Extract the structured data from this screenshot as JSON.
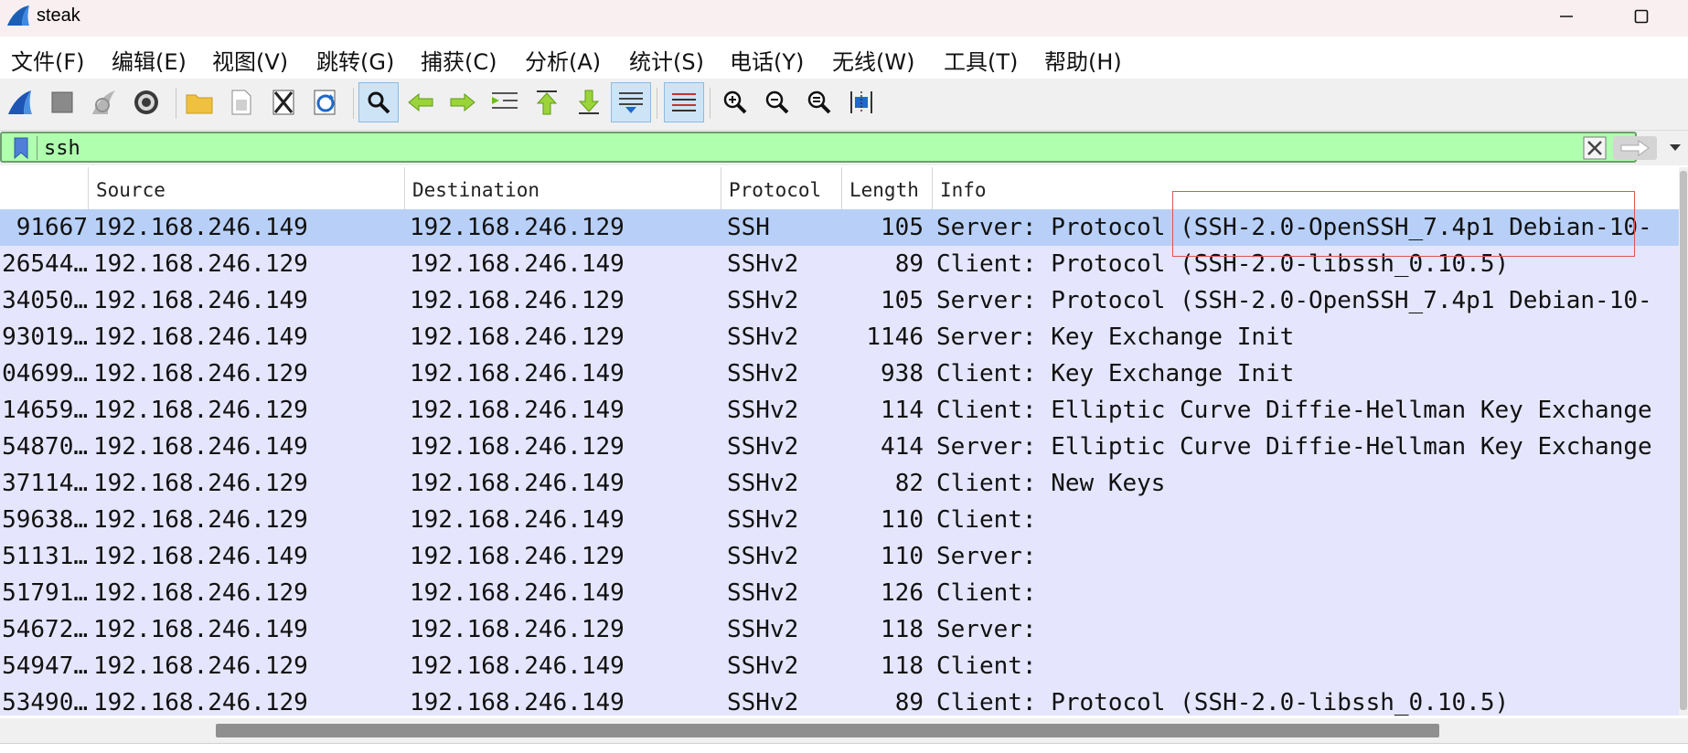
{
  "window": {
    "title": "steak",
    "minimize_label": "—",
    "maximize_label": ""
  },
  "menu": [
    {
      "label": "文件(F)"
    },
    {
      "label": "编辑(E)"
    },
    {
      "label": "视图(V)"
    },
    {
      "label": "跳转(G)"
    },
    {
      "label": "捕获(C)"
    },
    {
      "label": "分析(A)"
    },
    {
      "label": "统计(S)"
    },
    {
      "label": "电话(Y)"
    },
    {
      "label": "无线(W)"
    },
    {
      "label": "工具(T)"
    },
    {
      "label": "帮助(H)"
    }
  ],
  "toolbar": {
    "icons": [
      "start-capture-icon",
      "stop-capture-icon",
      "restart-capture-icon",
      "capture-options-icon",
      "open-file-icon",
      "save-file-icon",
      "close-file-icon",
      "reload-file-icon",
      "find-packet-icon",
      "go-back-icon",
      "go-forward-icon",
      "go-to-packet-icon",
      "first-packet-icon",
      "last-packet-icon",
      "autoscroll-icon",
      "colorize-icon",
      "zoom-in-icon",
      "zoom-out-icon",
      "normal-size-icon",
      "resize-columns-icon"
    ]
  },
  "filter": {
    "value": "ssh",
    "bg_color": "#afffaf"
  },
  "columns": {
    "no": "",
    "source": "Source",
    "destination": "Destination",
    "protocol": "Protocol",
    "length": "Length",
    "info": "Info"
  },
  "packets": [
    {
      "no": "91667",
      "source": "192.168.246.149",
      "destination": "192.168.246.129",
      "protocol": "SSH",
      "length": "105",
      "info": "Server: Protocol (SSH-2.0-OpenSSH_7.4p1 Debian-10-"
    },
    {
      "no": "26544…",
      "source": "192.168.246.129",
      "destination": "192.168.246.149",
      "protocol": "SSHv2",
      "length": "89",
      "info": "Client: Protocol (SSH-2.0-libssh_0.10.5)"
    },
    {
      "no": "34050…",
      "source": "192.168.246.149",
      "destination": "192.168.246.129",
      "protocol": "SSHv2",
      "length": "105",
      "info": "Server: Protocol (SSH-2.0-OpenSSH_7.4p1 Debian-10-"
    },
    {
      "no": "93019…",
      "source": "192.168.246.149",
      "destination": "192.168.246.129",
      "protocol": "SSHv2",
      "length": "1146",
      "info": "Server: Key Exchange Init"
    },
    {
      "no": "04699…",
      "source": "192.168.246.129",
      "destination": "192.168.246.149",
      "protocol": "SSHv2",
      "length": "938",
      "info": "Client: Key Exchange Init"
    },
    {
      "no": "14659…",
      "source": "192.168.246.129",
      "destination": "192.168.246.149",
      "protocol": "SSHv2",
      "length": "114",
      "info": "Client: Elliptic Curve Diffie-Hellman Key Exchange"
    },
    {
      "no": "54870…",
      "source": "192.168.246.149",
      "destination": "192.168.246.129",
      "protocol": "SSHv2",
      "length": "414",
      "info": "Server: Elliptic Curve Diffie-Hellman Key Exchange"
    },
    {
      "no": "37114…",
      "source": "192.168.246.129",
      "destination": "192.168.246.149",
      "protocol": "SSHv2",
      "length": "82",
      "info": "Client: New Keys"
    },
    {
      "no": "59638…",
      "source": "192.168.246.129",
      "destination": "192.168.246.149",
      "protocol": "SSHv2",
      "length": "110",
      "info": "Client:"
    },
    {
      "no": "51131…",
      "source": "192.168.246.149",
      "destination": "192.168.246.129",
      "protocol": "SSHv2",
      "length": "110",
      "info": "Server:"
    },
    {
      "no": "51791…",
      "source": "192.168.246.129",
      "destination": "192.168.246.149",
      "protocol": "SSHv2",
      "length": "126",
      "info": "Client:"
    },
    {
      "no": "54672…",
      "source": "192.168.246.149",
      "destination": "192.168.246.129",
      "protocol": "SSHv2",
      "length": "118",
      "info": "Server:"
    },
    {
      "no": "54947…",
      "source": "192.168.246.129",
      "destination": "192.168.246.149",
      "protocol": "SSHv2",
      "length": "118",
      "info": "Client:"
    },
    {
      "no": "53490…",
      "source": "192.168.246.129",
      "destination": "192.168.246.149",
      "protocol": "SSHv2",
      "length": "89",
      "info": "Client: Protocol (SSH-2.0-libssh_0.10.5)"
    }
  ],
  "selected_row": 0,
  "colors": {
    "row_bg": "#e5e5fd",
    "selected_bg": "#b8d0f7",
    "highlight_box": "#e05555"
  }
}
